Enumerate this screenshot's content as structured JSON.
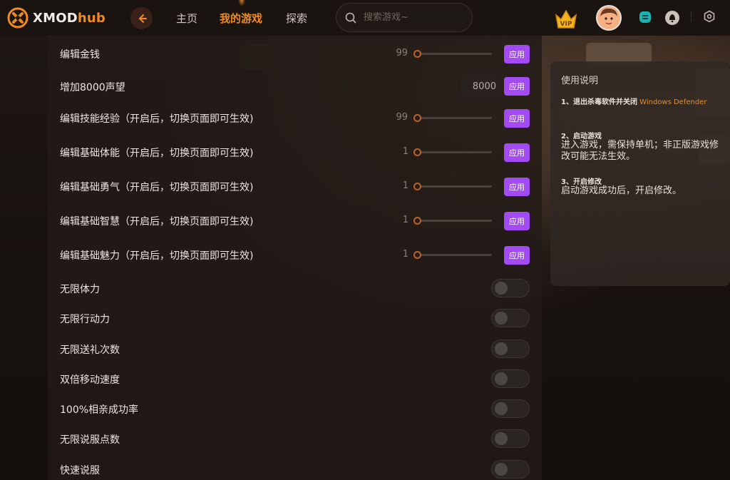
{
  "header": {
    "logo_text": "XMOD",
    "logo_text_accent": "hub",
    "nav": [
      {
        "label": "主页"
      },
      {
        "label": "我的游戏"
      },
      {
        "label": "探索"
      }
    ],
    "search_placeholder": "搜索游戏~",
    "vip_label": "VIP"
  },
  "cheats": {
    "apply_label": "应用",
    "slider_rows": [
      {
        "label": "编辑金钱",
        "value": "99"
      },
      {
        "label": "编辑技能经验（开启后，切换页面即可生效)",
        "value": "99"
      },
      {
        "label": "编辑基础体能（开启后，切换页面即可生效)",
        "value": "1"
      },
      {
        "label": "编辑基础勇气（开启后，切换页面即可生效)",
        "value": "1"
      },
      {
        "label": "编辑基础智慧（开启后，切换页面即可生效)",
        "value": "1"
      },
      {
        "label": "编辑基础魅力（开启后，切换页面即可生效)",
        "value": "1"
      }
    ],
    "input_row": {
      "label": "增加8000声望",
      "value": "8000"
    },
    "toggles": [
      {
        "label": "无限体力",
        "on": false
      },
      {
        "label": "无限行动力",
        "on": false
      },
      {
        "label": "无限送礼次数",
        "on": false
      },
      {
        "label": "双倍移动速度",
        "on": false
      },
      {
        "label": "100%相亲成功率",
        "on": false
      },
      {
        "label": "无限说服点数",
        "on": false
      },
      {
        "label": "快速说服",
        "on": false
      }
    ]
  },
  "info": {
    "title": "使用说明",
    "step1_title": "1、退出杀毒软件并关闭",
    "step1_highlight": "Windows Defender",
    "step2_title": "2、启动游戏",
    "step2_body": "进入游戏，需保持单机；非正版游戏修改可能无法生效。",
    "step3_title": "3、开启修改",
    "step3_body": "启动游戏成功后，开启修改。"
  },
  "colors": {
    "accent": "#f28a1e",
    "apply": "#a24bf2",
    "background": "#15100d"
  },
  "icons": [
    "logo-icon",
    "back-arrow-icon",
    "search-icon",
    "vip-crown-icon",
    "chat-icon",
    "bell-icon",
    "settings-icon"
  ]
}
